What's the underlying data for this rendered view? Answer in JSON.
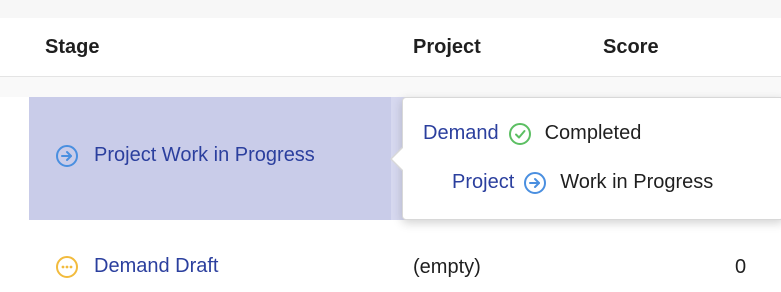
{
  "table": {
    "columns": {
      "stage": "Stage",
      "project": "Project",
      "score": "Score"
    },
    "rows": [
      {
        "stage_icon": "arrow-right-circle-icon",
        "stage_label": "Project Work in Progress",
        "project": "",
        "score": ""
      },
      {
        "stage_icon": "ellipsis-circle-icon",
        "stage_label": "Demand Draft",
        "project": "(empty)",
        "score": "0"
      }
    ]
  },
  "popover": {
    "lines": [
      {
        "kind": "Demand",
        "icon": "check-circle-icon",
        "status": "Completed"
      },
      {
        "kind": "Project",
        "icon": "arrow-right-circle-icon",
        "status": "Work in Progress"
      }
    ]
  },
  "colors": {
    "link": "#2b3f9e",
    "progress_blue": "#4a8fe0",
    "completed_green": "#5cbf63",
    "draft_yellow": "#f2bb3d",
    "row_highlight": "#c9cce9"
  }
}
